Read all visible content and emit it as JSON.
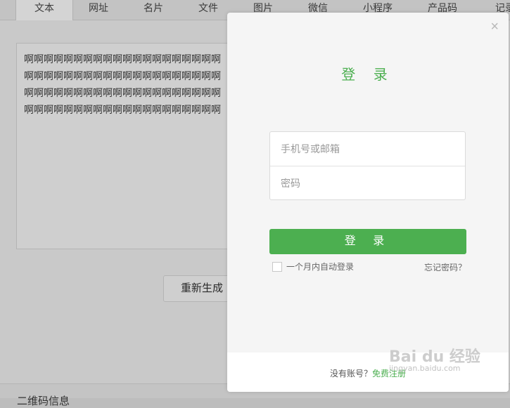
{
  "tabs": [
    "文本",
    "网址",
    "名片",
    "文件",
    "图片",
    "微信",
    "小程序",
    "产品码",
    "记录"
  ],
  "editor": {
    "lines": [
      "啊啊啊啊啊啊啊啊啊啊啊啊啊啊啊啊啊啊啊啊",
      "啊啊啊啊啊啊啊啊啊啊啊啊啊啊啊啊啊啊啊啊",
      "啊啊啊啊啊啊啊啊啊啊啊啊啊啊啊啊啊啊啊啊",
      "啊啊啊啊啊啊啊啊啊啊啊啊啊啊啊啊啊啊啊啊"
    ]
  },
  "regenerate_label": "重新生成",
  "bottom_title": "二维码信息",
  "login": {
    "close_symbol": "×",
    "title": "登 录",
    "username_placeholder": "手机号或邮箱",
    "password_placeholder": "密码",
    "submit_label": "登 录",
    "remember_label": "一个月内自动登录",
    "forgot_label": "忘记密码？",
    "no_account_text": "没有账号？",
    "register_label": "免费注册"
  },
  "watermark": {
    "logo": "Bai du 经验",
    "url": "jingyan.baidu.com"
  },
  "colors": {
    "accent": "#4caf50"
  }
}
